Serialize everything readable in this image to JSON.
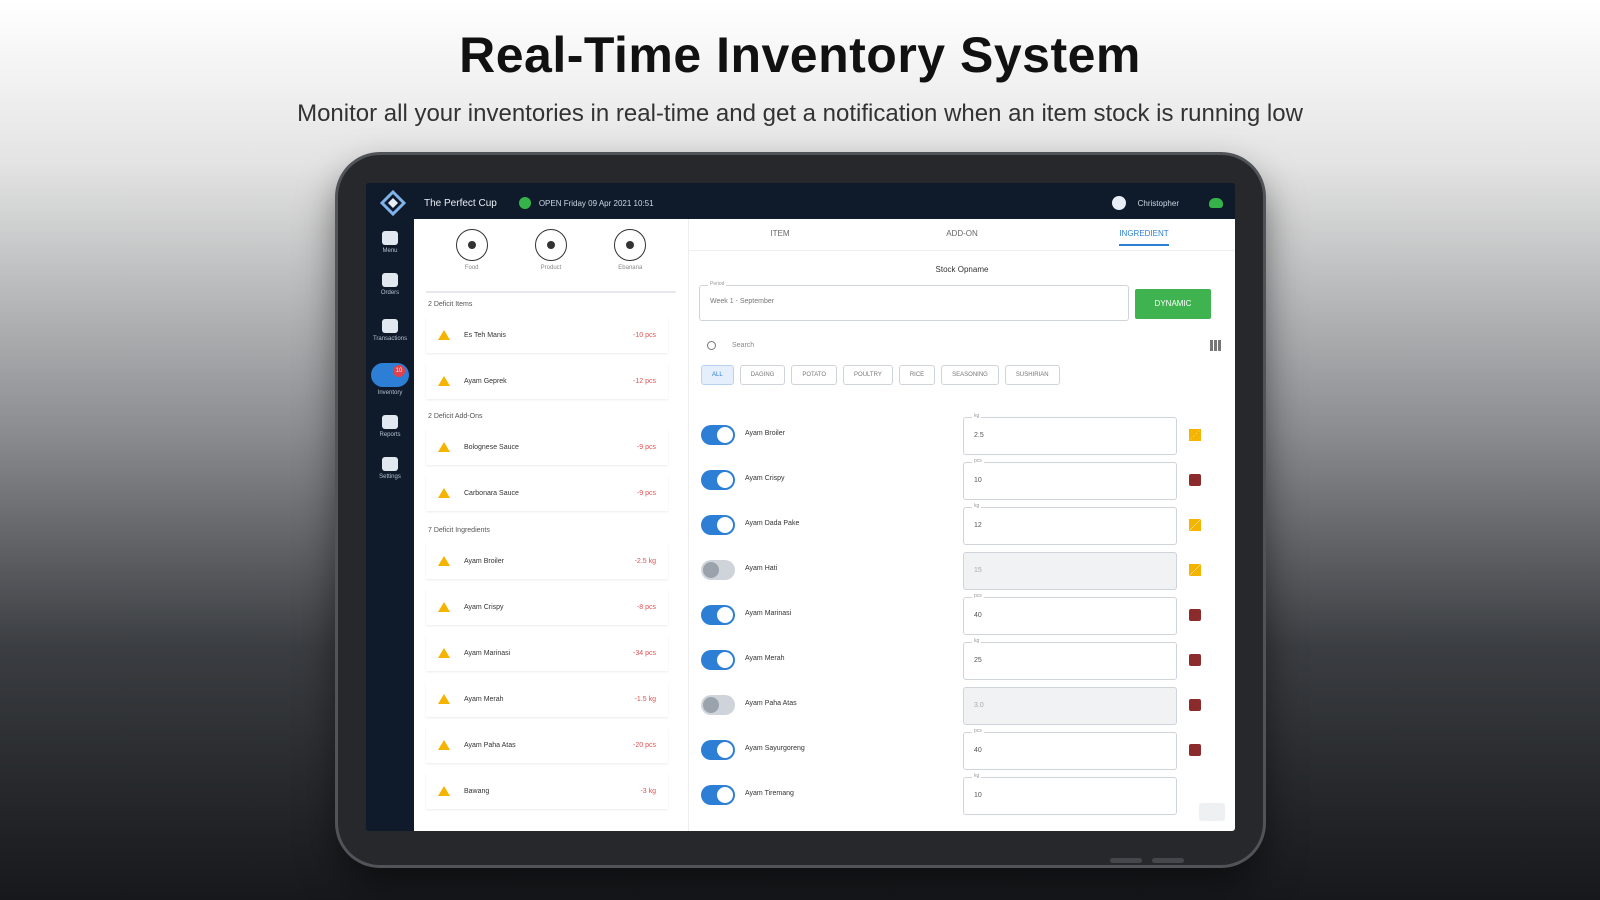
{
  "hero": {
    "title": "Real-Time Inventory System",
    "subtitle": "Monitor all your inventories in real-time and get a notification when an item stock is running low"
  },
  "topbar": {
    "store_name": "The Perfect Cup",
    "status_text": "OPEN Friday 09 Apr 2021 10:51",
    "user_name": "Christopher"
  },
  "sidebar": {
    "items": [
      {
        "label": "Menu",
        "icon": "menu-icon"
      },
      {
        "label": "Orders",
        "icon": "orders-icon"
      },
      {
        "label": "Transactions",
        "icon": "transactions-icon"
      },
      {
        "label": "Inventory",
        "icon": "inventory-icon",
        "badge": "10"
      },
      {
        "label": "Reports",
        "icon": "reports-icon"
      },
      {
        "label": "Settings",
        "icon": "settings-icon"
      }
    ]
  },
  "left_panel": {
    "shortcuts": [
      {
        "label": "Food"
      },
      {
        "label": "Product"
      },
      {
        "label": "Ebanana"
      }
    ],
    "sections": [
      {
        "title": "2 Deficit Items",
        "items": [
          {
            "name": "Es Teh Manis",
            "qty": "-10 pcs"
          },
          {
            "name": "Ayam Geprek",
            "qty": "-12 pcs"
          }
        ]
      },
      {
        "title": "2 Deficit Add-Ons",
        "items": [
          {
            "name": "Bolognese Sauce",
            "qty": "-9 pcs"
          },
          {
            "name": "Carbonara Sauce",
            "qty": "-9 pcs"
          }
        ]
      },
      {
        "title": "7 Deficit Ingredients",
        "items": [
          {
            "name": "Ayam Broiler",
            "qty": "-2.5 kg"
          },
          {
            "name": "Ayam Crispy",
            "qty": "-8 pcs"
          },
          {
            "name": "Ayam Marinasi",
            "qty": "-34 pcs"
          },
          {
            "name": "Ayam Merah",
            "qty": "-1.5 kg"
          },
          {
            "name": "Ayam Paha Atas",
            "qty": "-20 pcs"
          },
          {
            "name": "Bawang",
            "qty": "-3 kg"
          }
        ]
      }
    ]
  },
  "right_panel": {
    "tabs": [
      "ITEM",
      "ADD-ON",
      "INGREDIENT"
    ],
    "active_tab": 2,
    "stock_title": "Stock Opname",
    "period_label": "Period",
    "period_value": "Week 1 - September",
    "dynamic_button": "DYNAMIC",
    "search_placeholder": "Search",
    "chips": [
      "ALL",
      "DAGING",
      "POTATO",
      "POULTRY",
      "RICE",
      "SEASONING",
      "SUSHIRIAN"
    ],
    "active_chip": 0,
    "ingredients": [
      {
        "name": "Ayam Broiler",
        "on": true,
        "label": "kg",
        "value": "2.5",
        "icon": "hourglass-icon"
      },
      {
        "name": "Ayam Crispy",
        "on": true,
        "label": "pcs",
        "value": "10",
        "icon": "box-icon"
      },
      {
        "name": "Ayam Dada Pake",
        "on": true,
        "label": "kg",
        "value": "12",
        "icon": "hourglass-icon"
      },
      {
        "name": "Ayam Hati",
        "on": false,
        "label": "",
        "value": "15",
        "icon": "hourglass-icon"
      },
      {
        "name": "Ayam Marinasi",
        "on": true,
        "label": "pcs",
        "value": "40",
        "icon": "box-icon"
      },
      {
        "name": "Ayam Merah",
        "on": true,
        "label": "kg",
        "value": "25",
        "icon": "box-icon"
      },
      {
        "name": "Ayam Paha Atas",
        "on": false,
        "label": "",
        "value": "3.0",
        "icon": "box-icon"
      },
      {
        "name": "Ayam Sayurgoreng",
        "on": true,
        "label": "pcs",
        "value": "40",
        "icon": "box-icon"
      },
      {
        "name": "Ayam Tiremang",
        "on": true,
        "label": "kg",
        "value": "10",
        "icon": "keyboard-icon"
      }
    ]
  },
  "colors": {
    "accent": "#2d7fd6",
    "success": "#3fb34f",
    "warning": "#f4b400",
    "danger": "#e05252",
    "nav_bg": "#0f1a2b"
  }
}
